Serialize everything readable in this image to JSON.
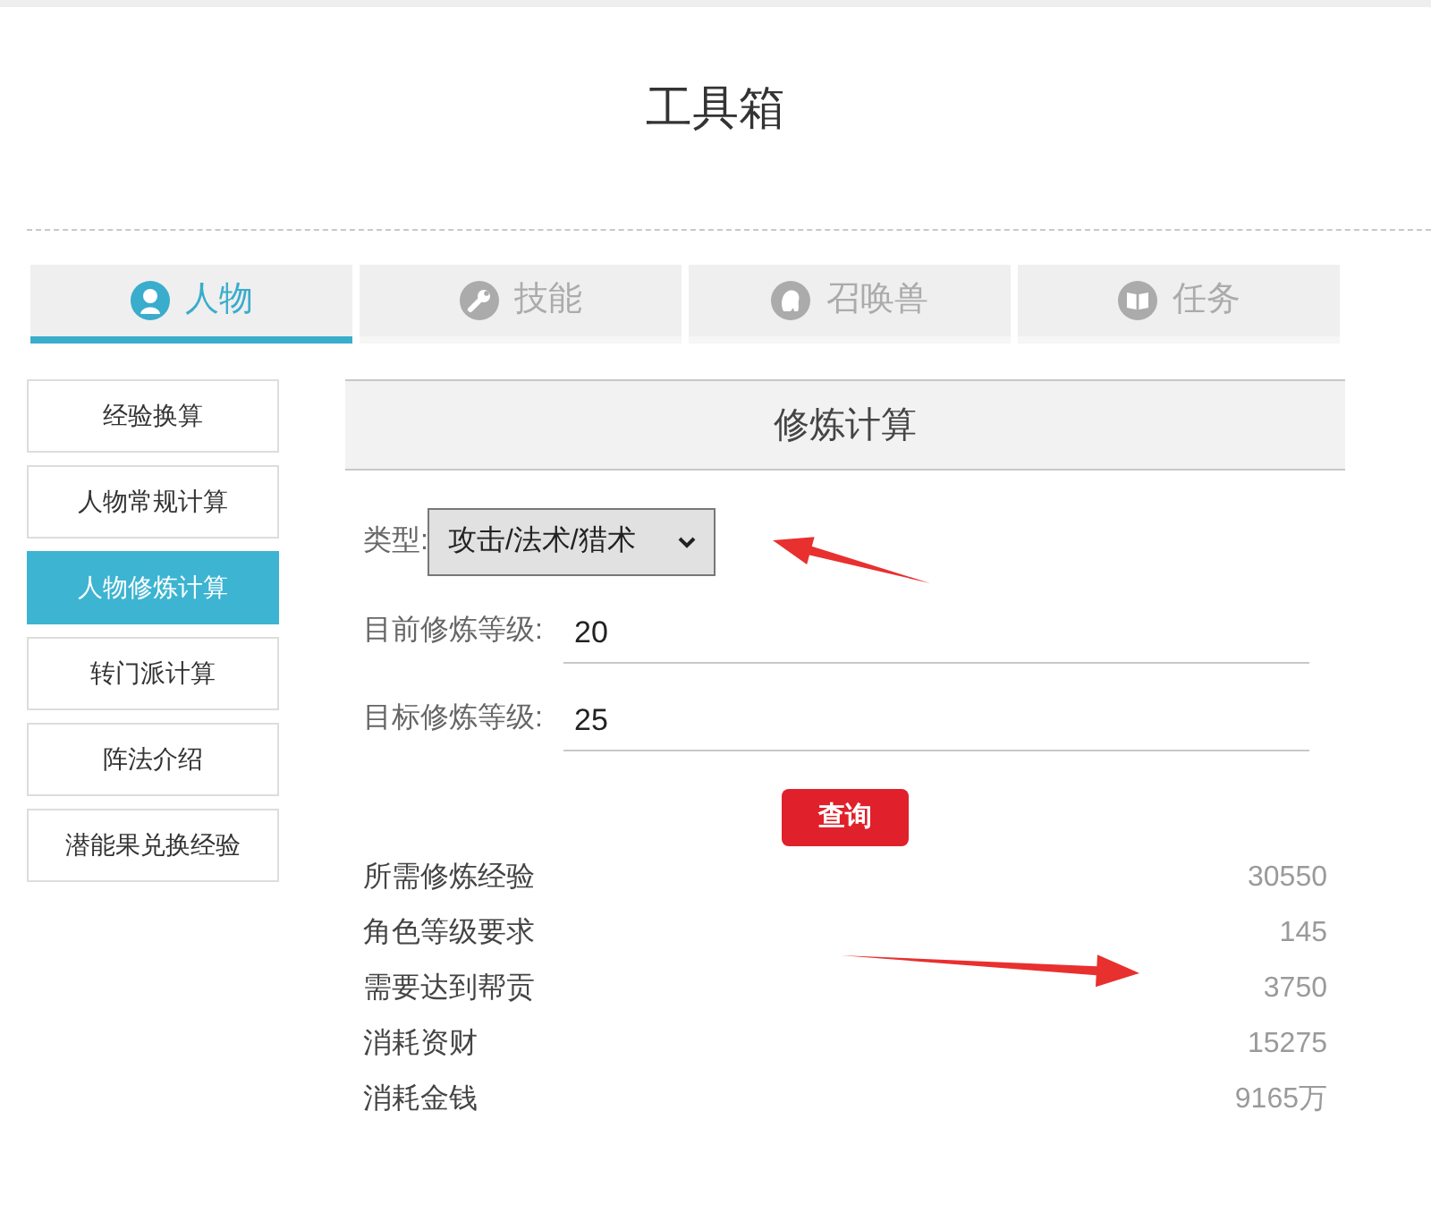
{
  "page": {
    "title": "工具箱"
  },
  "tabs": [
    {
      "kind": "person",
      "label": "人物",
      "selected": true
    },
    {
      "kind": "skill",
      "label": "技能",
      "selected": false
    },
    {
      "kind": "pet",
      "label": "召唤兽",
      "selected": false
    },
    {
      "kind": "quest",
      "label": "任务",
      "selected": false
    }
  ],
  "sidebar": {
    "items": [
      {
        "label": "经验换算",
        "selected": false
      },
      {
        "label": "人物常规计算",
        "selected": false
      },
      {
        "label": "人物修炼计算",
        "selected": true
      },
      {
        "label": "转门派计算",
        "selected": false
      },
      {
        "label": "阵法介绍",
        "selected": false
      },
      {
        "label": "潜能果兑换经验",
        "selected": false
      }
    ]
  },
  "panel": {
    "title": "修炼计算",
    "type_select": {
      "label": "类型:",
      "value": "攻击/法术/猎术"
    },
    "fields": [
      {
        "label": "目前修炼等级:",
        "value": "20"
      },
      {
        "label": "目标修炼等级:",
        "value": "25"
      }
    ],
    "button": "查询",
    "results": [
      {
        "label": "所需修炼经验",
        "value": "30550"
      },
      {
        "label": "角色等级要求",
        "value": "145"
      },
      {
        "label": "需要达到帮贡",
        "value": "3750"
      },
      {
        "label": "消耗资财",
        "value": "15275"
      },
      {
        "label": "消耗金钱",
        "value": "9165万"
      }
    ]
  }
}
